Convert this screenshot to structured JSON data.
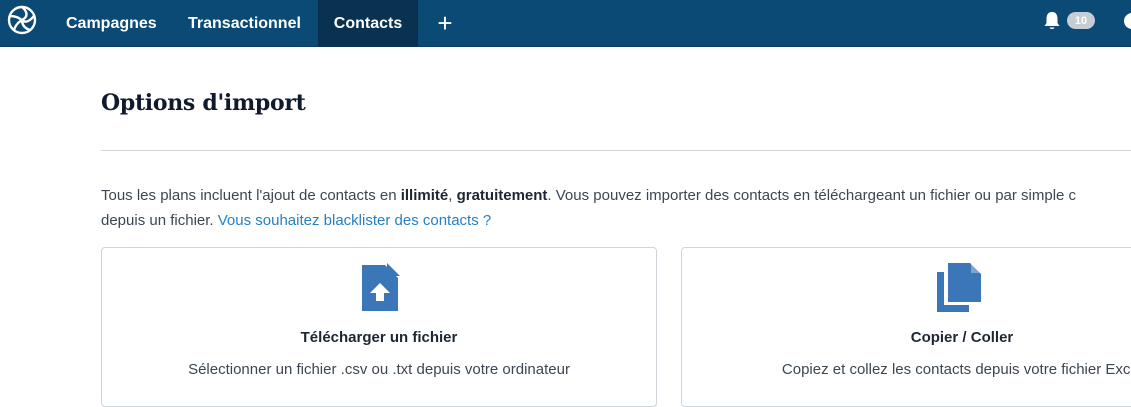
{
  "nav": {
    "items": [
      {
        "label": "Campagnes"
      },
      {
        "label": "Transactionnel"
      },
      {
        "label": "Contacts"
      }
    ],
    "add_label": "+",
    "notification_count": "10"
  },
  "main": {
    "title": "Options d'import",
    "intro": {
      "part1": "Tous les plans incluent l'ajout de contacts en ",
      "bold1": "illimité",
      "comma": ", ",
      "bold2": "gratuitement",
      "part2": ". Vous pouvez importer des contacts en téléchargeant un fichier ou par simple c",
      "part3": "depuis un fichier. ",
      "link": "Vous souhaitez blacklister des contacts ?"
    },
    "cards": [
      {
        "title": "Télécharger un fichier",
        "description": "Sélectionner un fichier .csv ou .txt depuis votre ordinateur",
        "icon": "file-upload-icon"
      },
      {
        "title": "Copier / Coller",
        "description": "Copiez et collez les contacts depuis votre fichier Excel",
        "icon": "copy-icon"
      }
    ]
  },
  "colors": {
    "navbar": "#0b4a74",
    "nav_active": "#08324f",
    "icon_blue": "#3a76b8",
    "link": "#2680c2"
  }
}
